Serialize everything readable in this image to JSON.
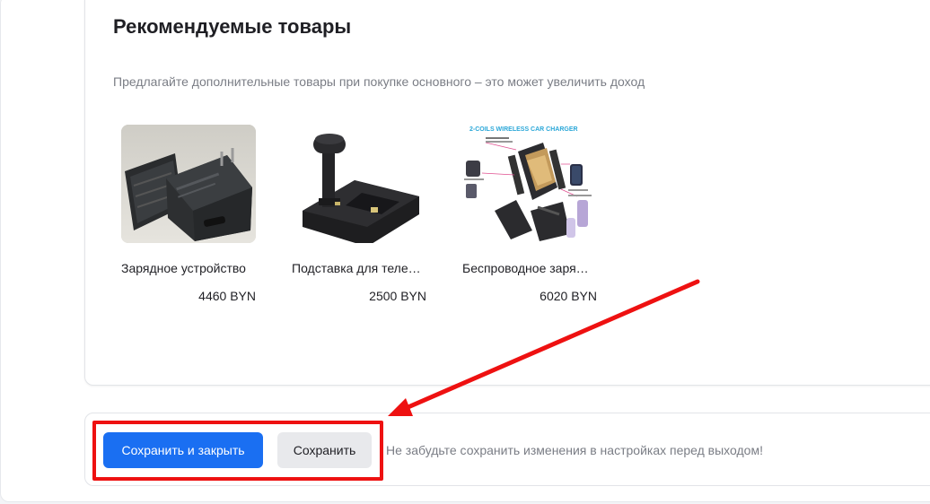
{
  "section": {
    "title": "Рекомендуемые товары",
    "subtitle": "Предлагайте дополнительные товары при покупке основного – это может увеличить доход"
  },
  "products": [
    {
      "name": "Зарядное устройство",
      "price": "4460 BYN",
      "icon": "charger-image"
    },
    {
      "name": "Подставка для теле…",
      "price": "2500 BYN",
      "icon": "phone-stand-image"
    },
    {
      "name": "Беспроводное заря…",
      "price": "6020 BYN",
      "icon": "car-charger-image",
      "image_caption": "2-COILS WIRELESS CAR CHARGER"
    }
  ],
  "footer": {
    "save_close_label": "Сохранить и закрыть",
    "save_label": "Сохранить",
    "note": "Не забудьте сохранить изменения в настройках перед выходом!"
  },
  "colors": {
    "primary": "#1a6ff2",
    "secondary_bg": "#e8e9ec",
    "annotation": "#ee1111",
    "muted_text": "#7a7d85"
  }
}
